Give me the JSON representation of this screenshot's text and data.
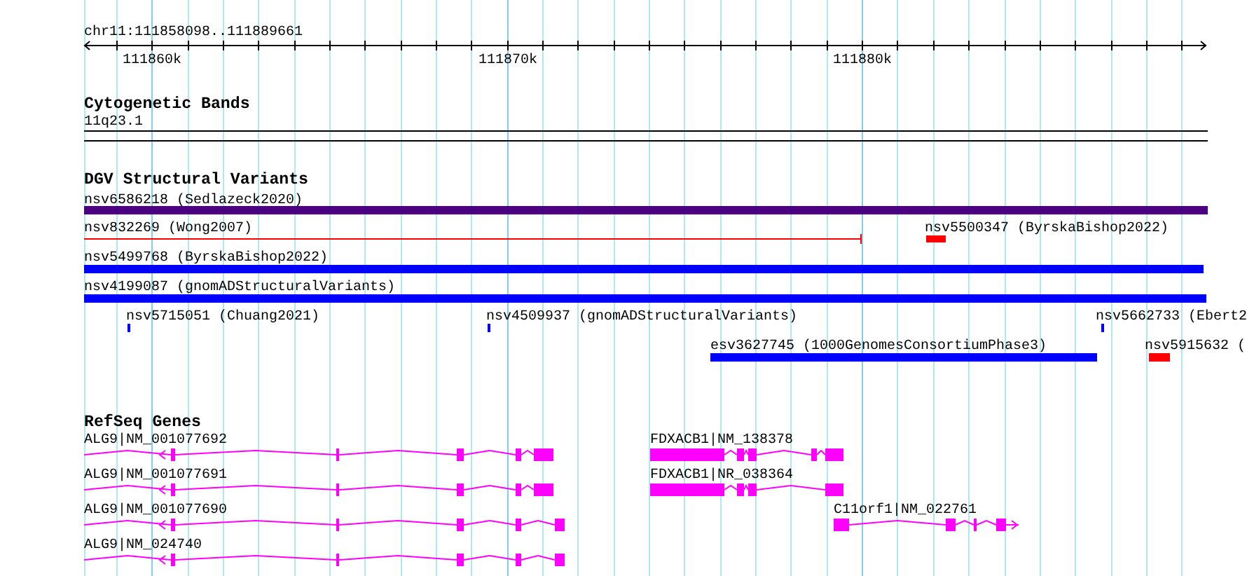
{
  "location": "chr11:111858098..111889661",
  "ruler": {
    "ticks": [
      "111860k",
      "111870k",
      "111880k"
    ]
  },
  "tracks": [
    {
      "title": "Cytogenetic Bands",
      "kind": "bands",
      "features": [
        {
          "label": "11q23.1"
        }
      ]
    },
    {
      "title": "DGV Structural Variants",
      "kind": "variants",
      "features": [
        {
          "label": "nsv6586218 (Sedlazeck2020)",
          "color": "#4b0082",
          "kind": "bar"
        },
        {
          "label": "nsv832269 (Wong2007)",
          "color": "#ff0000",
          "kind": "line"
        },
        {
          "label": "nsv5500347 (ByrskaBishop2022)",
          "color": "#ff0000",
          "kind": "bar"
        },
        {
          "label": "nsv5499768 (ByrskaBishop2022)",
          "color": "#0000ff",
          "kind": "bar"
        },
        {
          "label": "nsv4199087 (gnomADStructuralVariants)",
          "color": "#0000ff",
          "kind": "bar"
        },
        {
          "label": "nsv5715051 (Chuang2021)",
          "color": "#0000ff",
          "kind": "bar"
        },
        {
          "label": "nsv4509937 (gnomADStructuralVariants)",
          "color": "#0000ff",
          "kind": "bar"
        },
        {
          "label": "nsv5662733 (Ebert2",
          "color": "#0000ff",
          "kind": "bar"
        },
        {
          "label": "esv3627745 (1000GenomesConsortiumPhase3)",
          "color": "#0000ff",
          "kind": "bar"
        },
        {
          "label": "nsv5915632 (",
          "color": "#ff0000",
          "kind": "bar"
        }
      ]
    },
    {
      "title": "RefSeq Genes",
      "kind": "genes",
      "features": [
        {
          "label": "ALG9|NM_001077692"
        },
        {
          "label": "ALG9|NM_001077691"
        },
        {
          "label": "ALG9|NM_001077690"
        },
        {
          "label": "ALG9|NM_024740"
        },
        {
          "label": "FDXACB1|NM_138378"
        },
        {
          "label": "FDXACB1|NR_038364"
        },
        {
          "label": "C11orf1|NM_022761"
        }
      ]
    }
  ]
}
